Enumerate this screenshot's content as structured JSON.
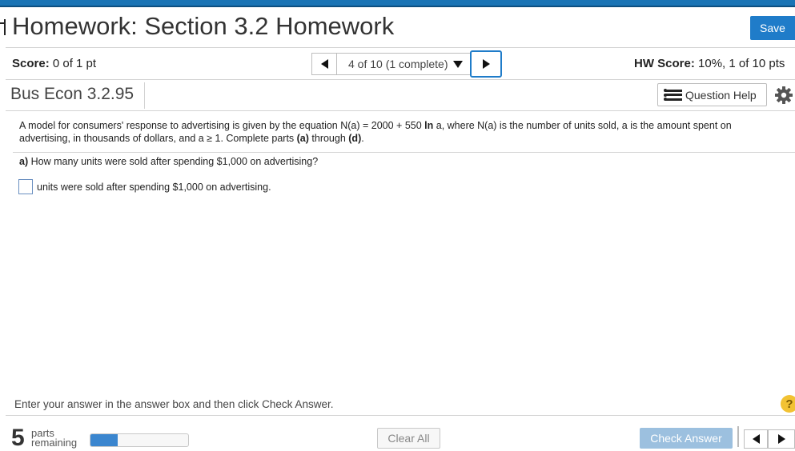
{
  "header": {
    "title": "Homework: Section 3.2 Homework",
    "save_label": "Save"
  },
  "score_bar": {
    "score_label": "Score:",
    "score_value": "0 of 1 pt",
    "question_selector": "4 of 10 (1 complete)",
    "hw_score_label": "HW Score:",
    "hw_score_value": "10%, 1 of 10 pts"
  },
  "problem_bar": {
    "problem_id": "Bus Econ 3.2.95",
    "question_help_label": "Question Help",
    "icons": [
      "list-icon",
      "gear-icon",
      "chevron-left-icon",
      "chevron-right-icon",
      "chevron-down-icon",
      "help-icon"
    ]
  },
  "problem": {
    "intro_1": "A model for consumers' response to advertising is given by the equation N(a) = 2000 + 550 ",
    "ln": "ln",
    "intro_2": " a, where N(a) is the number of units sold, a is the amount spent on advertising, in thousands of dollars, and a ≥ 1. Complete parts ",
    "part_a_ref": "(a)",
    "through": " through ",
    "part_d_ref": "(d)",
    "period": ".",
    "part_label": "a)",
    "part_question": " How many units were sold after spending $1,000 on advertising?",
    "answer_input_value": "",
    "answer_suffix": "units were sold after spending $1,000 on advertising."
  },
  "footer": {
    "instructions": "Enter your answer in the answer box and then click Check Answer.",
    "help_glyph": "?",
    "parts_remaining_count": "5",
    "parts_word": "parts",
    "remaining_word": "remaining",
    "progress_fraction": 0.28,
    "clear_all_label": "Clear All",
    "check_answer_label": "Check Answer"
  },
  "colors": {
    "accent": "#1f7cc9",
    "stripe": "#1a74b5",
    "check_disabled": "#9cc0df",
    "progress": "#3b86cf",
    "help_yellow": "#f2c233"
  }
}
